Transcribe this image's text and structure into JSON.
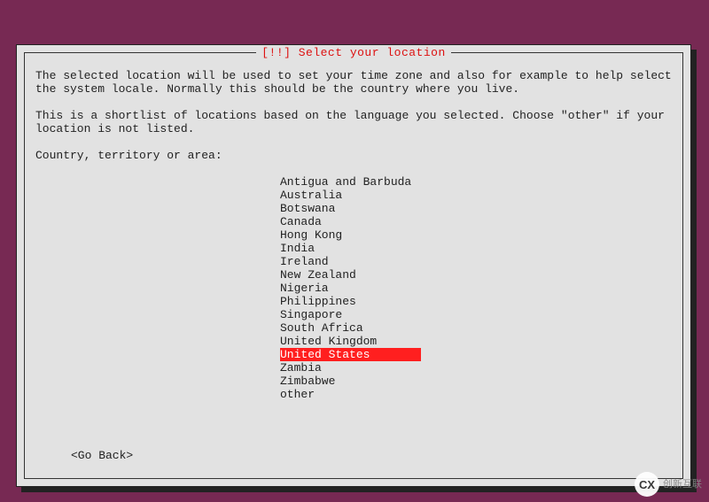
{
  "dialog": {
    "title": "[!!] Select your location",
    "para1": "The selected location will be used to set your time zone and also for example to help select the system locale. Normally this should be the country where you live.",
    "para2": "This is a shortlist of locations based on the language you selected. Choose \"other\" if your location is not listed.",
    "prompt": "Country, territory or area:",
    "go_back": "<Go Back>"
  },
  "locations": [
    "Antigua and Barbuda",
    "Australia",
    "Botswana",
    "Canada",
    "Hong Kong",
    "India",
    "Ireland",
    "New Zealand",
    "Nigeria",
    "Philippines",
    "Singapore",
    "South Africa",
    "United Kingdom",
    "United States",
    "Zambia",
    "Zimbabwe",
    "other"
  ],
  "selected_index": 13,
  "watermark": {
    "icon": "CX",
    "text": "创新互联"
  }
}
